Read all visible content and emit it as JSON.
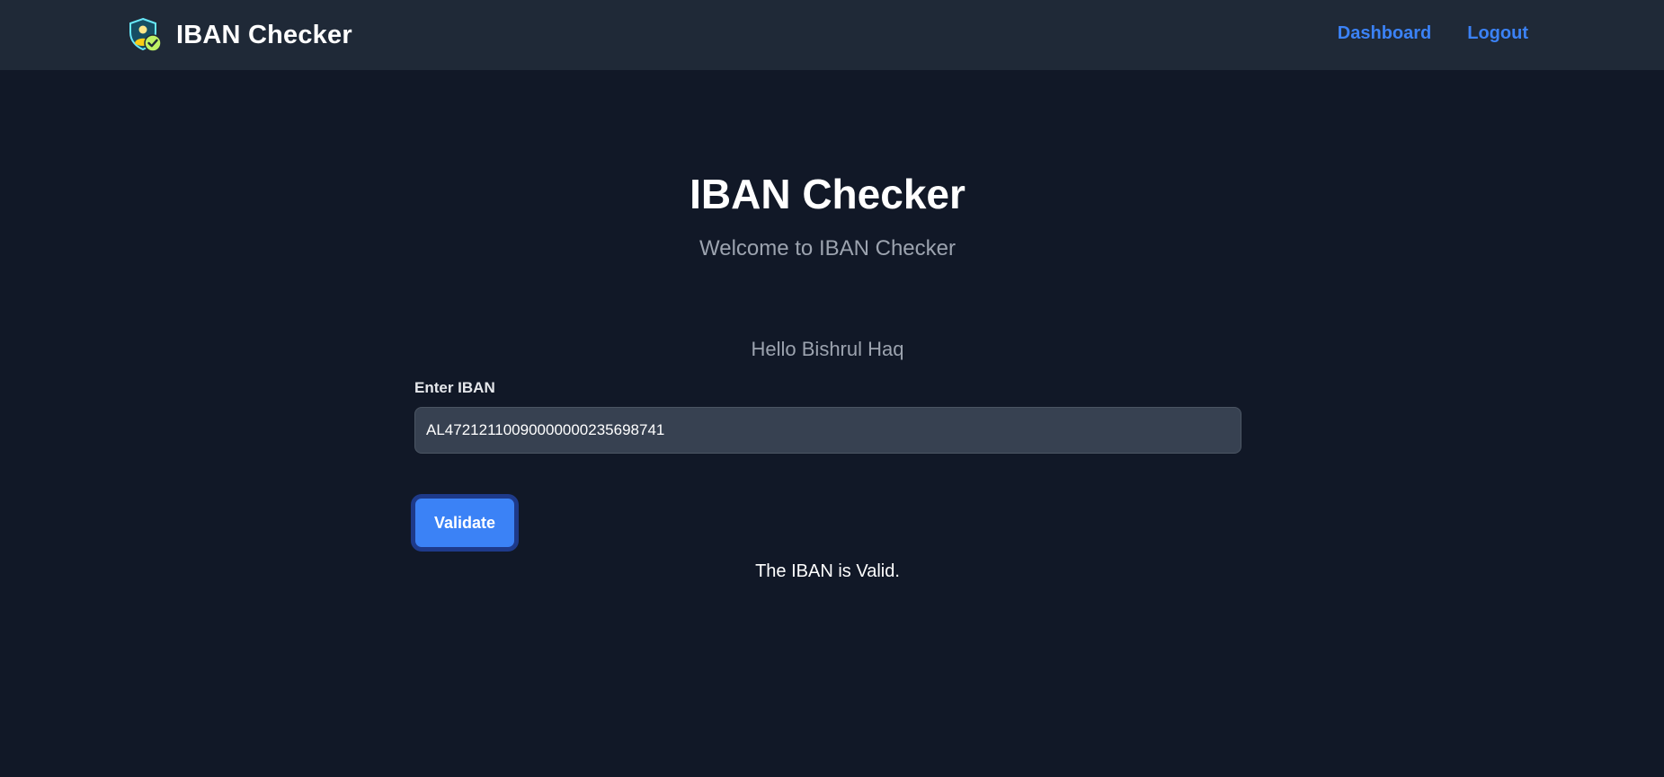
{
  "navbar": {
    "brand_title": "IBAN Checker",
    "links": {
      "dashboard": "Dashboard",
      "logout": "Logout"
    },
    "logo_icon": "shield-check-icon"
  },
  "hero": {
    "title": "IBAN Checker",
    "subtitle": "Welcome to IBAN Checker"
  },
  "greeting": "Hello Bishrul Haq",
  "form": {
    "label": "Enter IBAN",
    "iban_value": "AL47212110090000000235698741",
    "validate_label": "Validate"
  },
  "result": {
    "message": "The IBAN is Valid."
  },
  "colors": {
    "page_background": "#111827",
    "navbar_background": "#1f2937",
    "accent": "#3b82f6",
    "input_background": "#374151",
    "muted_text": "#9ca3af"
  }
}
